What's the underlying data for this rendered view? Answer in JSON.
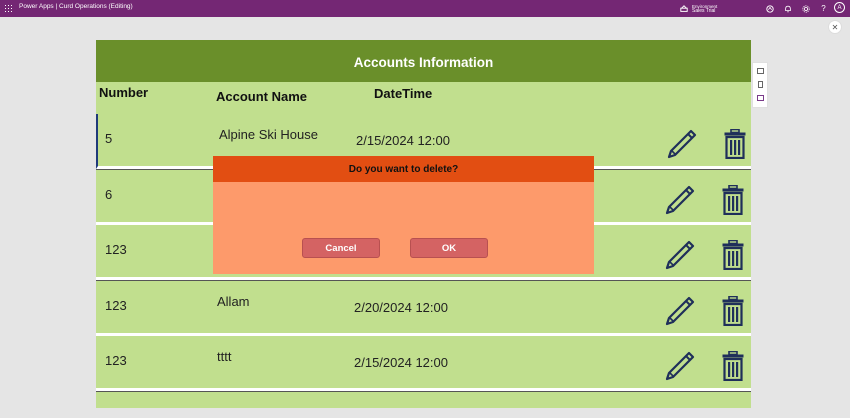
{
  "topbar": {
    "app_name": "Power Apps",
    "separator": "|",
    "document_title": "Curd Operations (Editing)",
    "environment_label": "Environment",
    "environment_name": "Sales Trial",
    "avatar_initial": "A",
    "help_glyph": "?"
  },
  "screen": {
    "title": "Accounts Information",
    "headers": {
      "number": "Number",
      "account_name": "Account Name",
      "datetime": "DateTime"
    },
    "rows": [
      {
        "number": "5",
        "account_name": "Alpine Ski House",
        "datetime": "2/15/2024 12:00"
      },
      {
        "number": "6",
        "account_name": "",
        "datetime": ""
      },
      {
        "number": "123",
        "account_name": "",
        "datetime": ""
      },
      {
        "number": "123",
        "account_name": "Allam",
        "datetime": "2/20/2024 12:00"
      },
      {
        "number": "123",
        "account_name": "tttt",
        "datetime": "2/15/2024 12:00"
      }
    ]
  },
  "dialog": {
    "question": "Do you want to delete?",
    "cancel_label": "Cancel",
    "ok_label": "OK"
  },
  "icons": {
    "edit": "pencil-icon",
    "delete": "trash-icon"
  },
  "colors": {
    "topbar": "#742774",
    "title_bar": "#6a8f2a",
    "row_bg": "#c1df8e",
    "dialog_header": "#e24e12",
    "dialog_body": "#fd9a6b",
    "dialog_button": "#d46363",
    "icon": "#1f2f5a"
  }
}
